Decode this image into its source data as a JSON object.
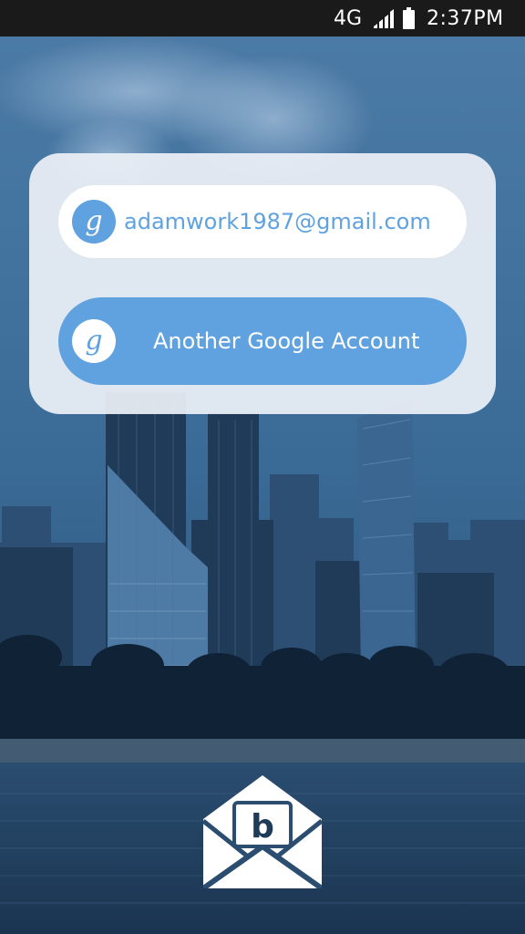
{
  "status_bar": {
    "network": "4G",
    "time": "2:37PM",
    "signal_icon": "signal-icon",
    "battery_icon": "battery-icon"
  },
  "account_picker": {
    "accounts": [
      {
        "email": "adamwork1987@gmail.com",
        "icon": "google-g-icon"
      }
    ],
    "add_account_label": "Another Google Account",
    "add_account_icon": "google-g-icon",
    "badge_glyph": "g"
  },
  "app": {
    "logo_icon": "envelope-b-logo-icon",
    "logo_glyph": "b"
  },
  "colors": {
    "accent": "#5fa2df",
    "card": "#ecf0f6",
    "status_bar": "#1a1a1a",
    "background_sky": "#3f6f9c",
    "background_water": "#1d3a57"
  }
}
